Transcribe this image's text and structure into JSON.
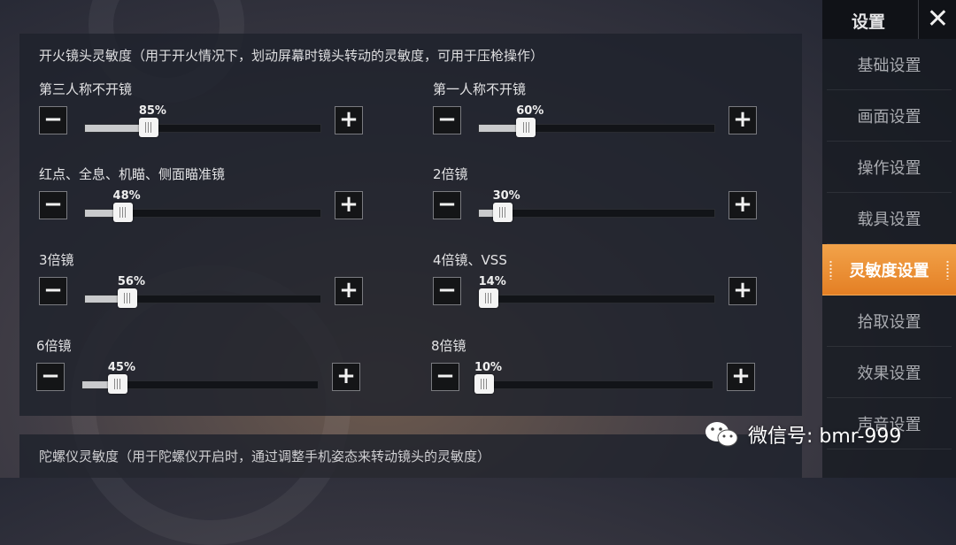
{
  "fire_scope": {
    "title": "开火镜头灵敏度（用于开火情况下，划动屏幕时镜头转动的灵敏度，可用于压枪操作）",
    "sliders": [
      {
        "label": "第三人称不开镜",
        "percent": "85%",
        "fraction": 0.27
      },
      {
        "label": "第一人称不开镜",
        "percent": "60%",
        "fraction": 0.2
      },
      {
        "label": "红点、全息、机瞄、侧面瞄准镜",
        "percent": "48%",
        "fraction": 0.16
      },
      {
        "label": "2倍镜",
        "percent": "30%",
        "fraction": 0.1
      },
      {
        "label": "3倍镜",
        "percent": "56%",
        "fraction": 0.18
      },
      {
        "label": "4倍镜、VSS",
        "percent": "14%",
        "fraction": 0.04
      },
      {
        "label": "6倍镜",
        "percent": "45%",
        "fraction": 0.15
      },
      {
        "label": "8倍镜",
        "percent": "10%",
        "fraction": 0.03
      }
    ],
    "minus_glyph": "−",
    "plus_glyph": "+"
  },
  "gyro": {
    "title": "陀螺仪灵敏度（用于陀螺仪开启时，通过调整手机姿态来转动镜头的灵敏度）"
  },
  "sidebar": {
    "title": "设置",
    "close_glyph": "✕",
    "items": [
      {
        "label": "基础设置"
      },
      {
        "label": "画面设置"
      },
      {
        "label": "操作设置"
      },
      {
        "label": "载具设置"
      },
      {
        "label": "灵敏度设置",
        "active": true
      },
      {
        "label": "拾取设置"
      },
      {
        "label": "效果设置"
      },
      {
        "label": "声音设置"
      }
    ]
  },
  "watermark": {
    "text": "微信号: bmr-999",
    "icon": "wechat-icon"
  },
  "colors": {
    "accent": "#e88a2c",
    "panel": "#1e222c"
  }
}
